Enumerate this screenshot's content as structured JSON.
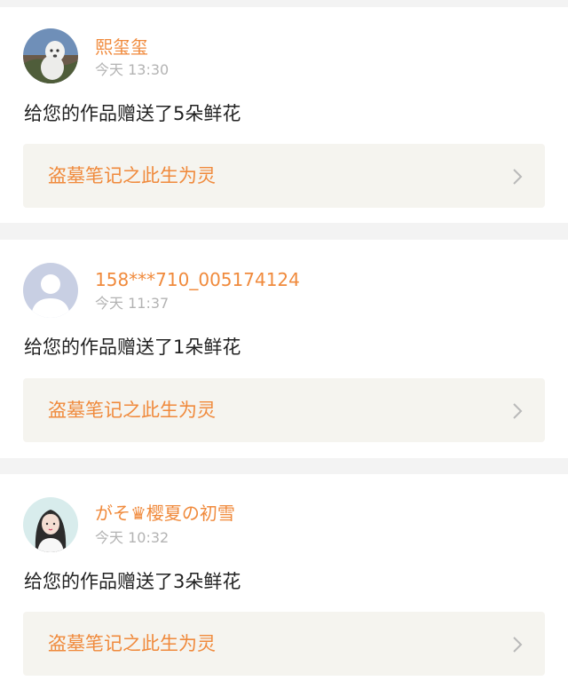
{
  "notifications": [
    {
      "username": "熙玺玺",
      "time": "今天 13:30",
      "message": "给您的作品赠送了5朵鲜花",
      "work_title": "盗墓笔记之此生为灵",
      "avatar_icon": "dog-photo-avatar",
      "chevron_icon": "chevron-right-icon"
    },
    {
      "username": "158***710_005174124",
      "time": "今天 11:37",
      "message": "给您的作品赠送了1朵鲜花",
      "work_title": "盗墓笔记之此生为灵",
      "avatar_icon": "default-user-avatar",
      "chevron_icon": "chevron-right-icon"
    },
    {
      "username": "がそ♛樱夏の初雪",
      "time": "今天 10:32",
      "message": "给您的作品赠送了3朵鲜花",
      "work_title": "盗墓笔记之此生为灵",
      "avatar_icon": "girl-photo-avatar",
      "chevron_icon": "chevron-right-icon"
    }
  ],
  "colors": {
    "accent": "#f08a3c",
    "muted_text": "#b3b3b3",
    "body_text": "#222222",
    "link_background": "#f5f4ef",
    "page_background": "#f3f3f3"
  }
}
